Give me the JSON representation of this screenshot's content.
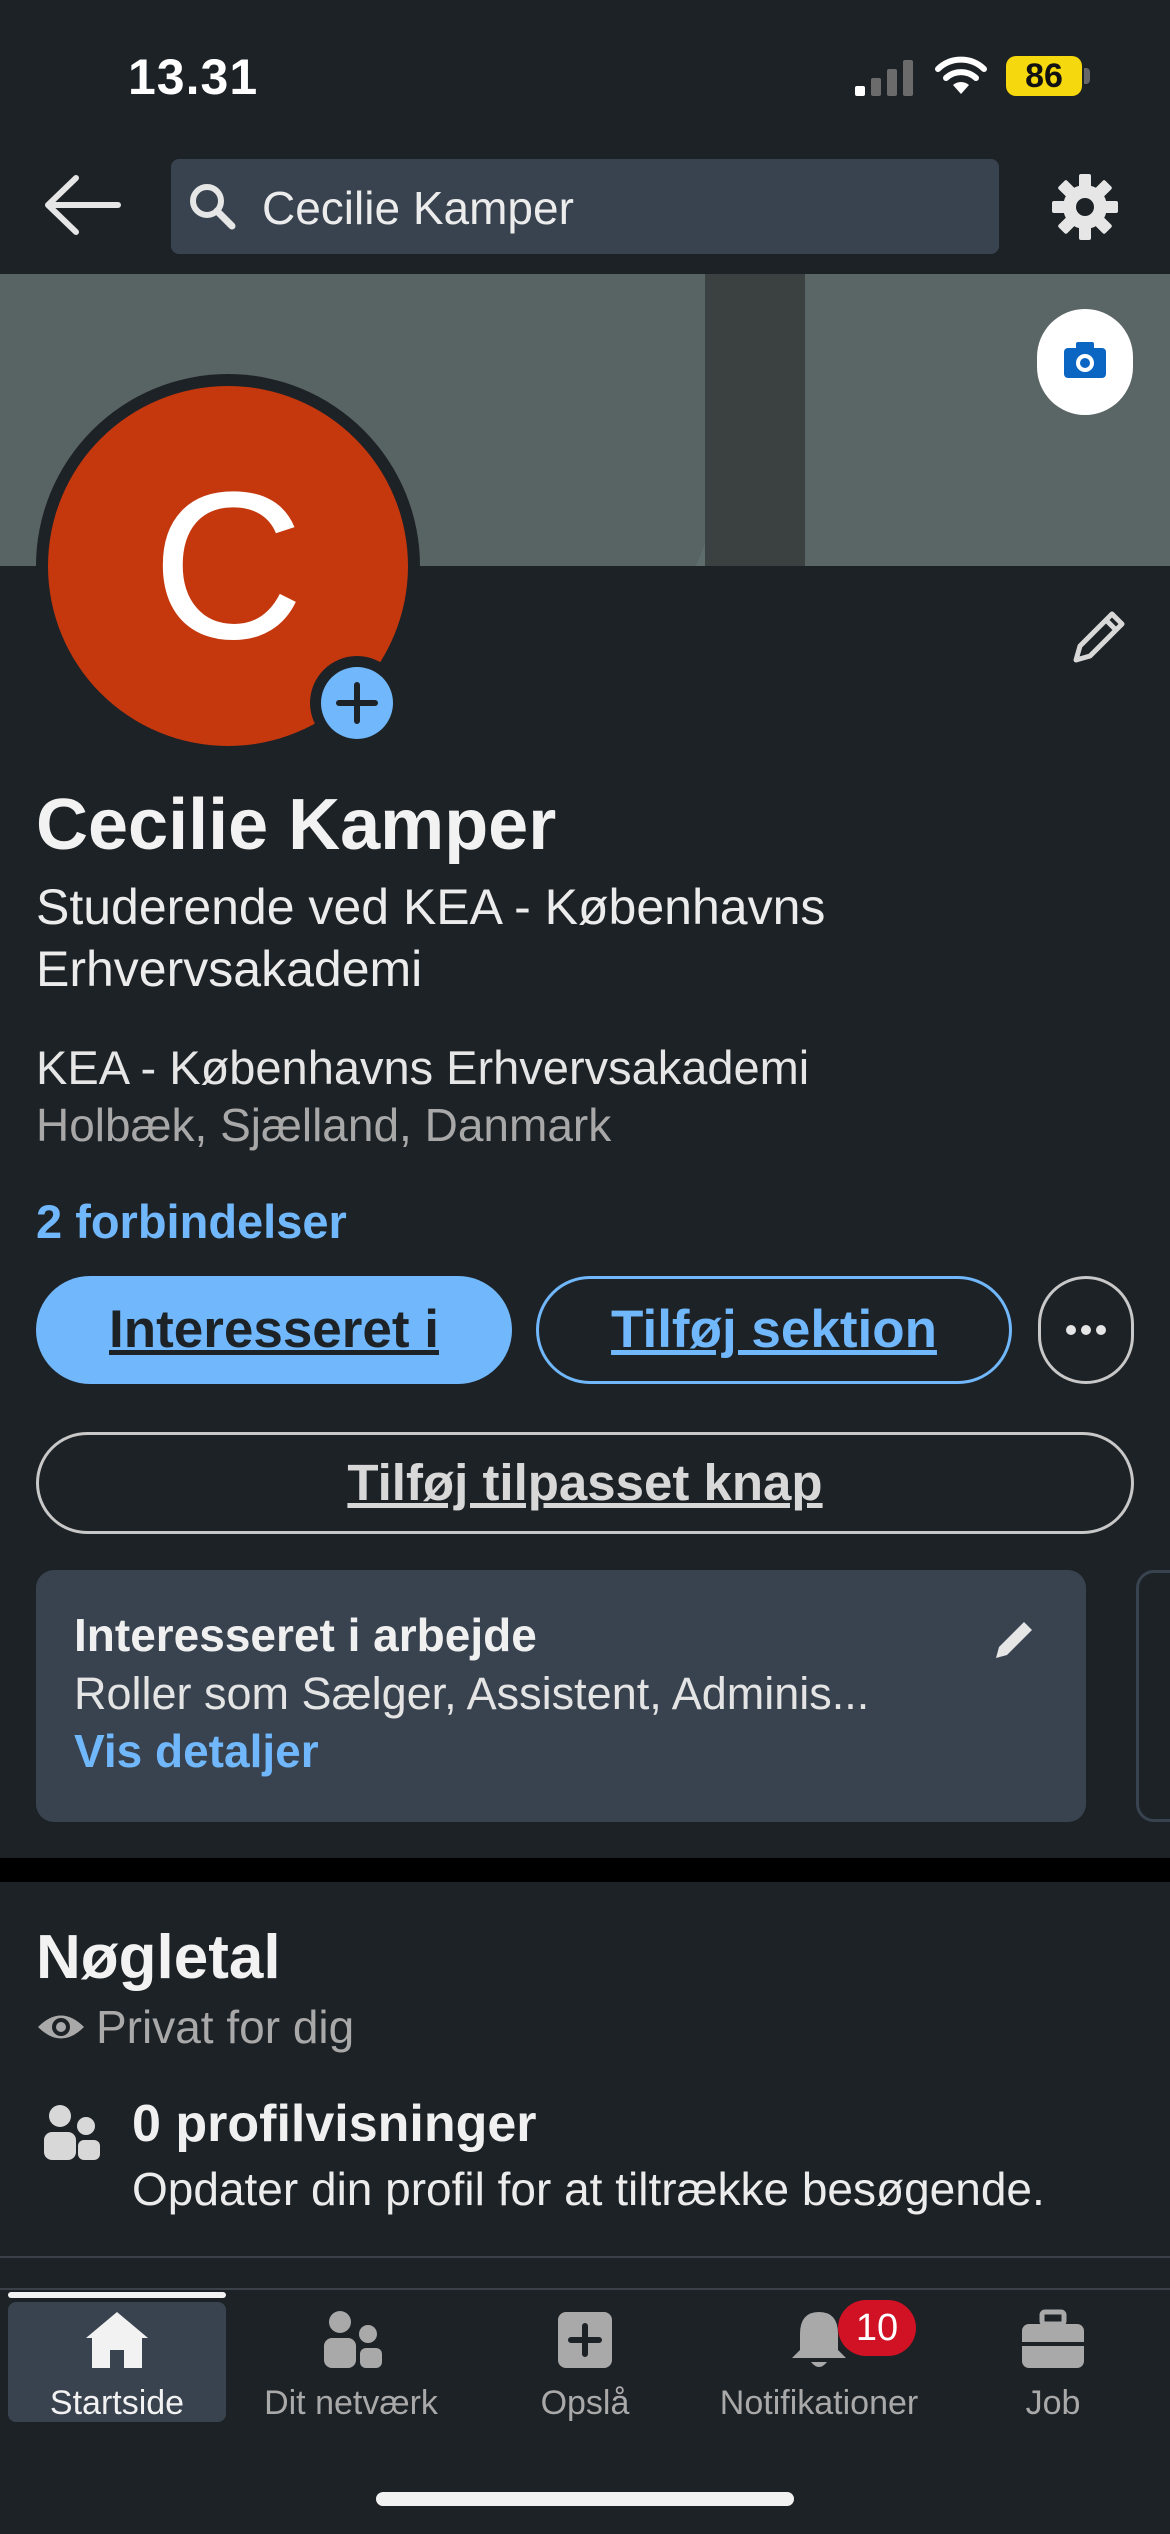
{
  "status_bar": {
    "time": "13.31",
    "battery": "86",
    "icons": [
      "signal-icon",
      "wifi-icon",
      "battery-icon"
    ]
  },
  "top_nav": {
    "back_icon": "back-arrow-icon",
    "search_icon": "search-icon",
    "search_value": "Cecilie Kamper",
    "settings_icon": "gear-icon"
  },
  "banner": {
    "camera_icon": "camera-icon"
  },
  "profile": {
    "avatar_initial": "C",
    "name": "Cecilie Kamper",
    "headline": "Studerende ved KEA - Københavns Erhvervsakademi",
    "company": "KEA - Københavns Erhvervsakademi",
    "location": "Holbæk, Sjælland, Danmark",
    "connections": "2 forbindelser"
  },
  "actions": {
    "primary": "Interesseret i",
    "secondary": "Tilføj sektion",
    "more_icon": "more-dots-icon",
    "custom_button": "Tilføj tilpasset knap"
  },
  "open_to_work": {
    "title": "Interesseret i arbejde",
    "description": "Roller som Sælger, Assistent, Adminis...",
    "link": "Vis detaljer"
  },
  "key_figures": {
    "title": "Nøgletal",
    "privacy": "Privat for dig",
    "views": "0 profilvisninger",
    "views_sub": "Opdater din profil for at tiltrække besøgende."
  },
  "tabs": [
    {
      "label": "Startside",
      "icon": "home-icon",
      "active": true
    },
    {
      "label": "Dit netværk",
      "icon": "network-icon",
      "active": false
    },
    {
      "label": "Opslå",
      "icon": "post-icon",
      "active": false
    },
    {
      "label": "Notifikationer",
      "icon": "bell-icon",
      "active": false,
      "badge": "10"
    },
    {
      "label": "Job",
      "icon": "briefcase-icon",
      "active": false
    }
  ],
  "colors": {
    "background": "#1d2226",
    "accent": "#71b7fb",
    "card": "#38434f",
    "avatar": "#c5380e",
    "badge": "#d11124"
  }
}
